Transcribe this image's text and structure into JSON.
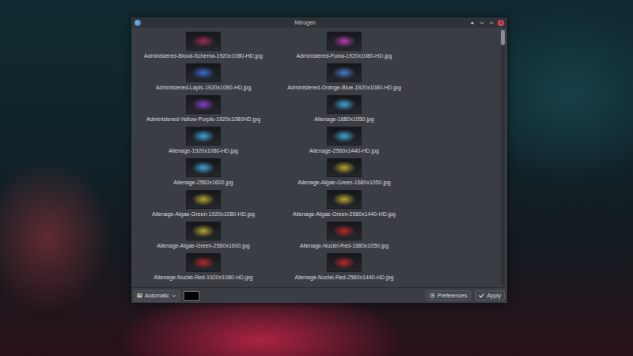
{
  "window": {
    "title": "Nitrogen"
  },
  "wallpapers": [
    {
      "name": "Administered-Blood-Schema-1920x1080-HD.jpg",
      "color": "#9a2c5a"
    },
    {
      "name": "Administered-Fuxia-1920x1080-HD.jpg",
      "color": "#b03aa8"
    },
    {
      "name": "Administered-Lapis-1920x1080-HD.jpg",
      "color": "#3a6ad0"
    },
    {
      "name": "Administered-Orange-Blue-1920x1080-HD.jpg",
      "color": "#4a78c8"
    },
    {
      "name": "Administered-Yellow-Purple-1920x1080HD.jpg",
      "color": "#8a3cc8"
    },
    {
      "name": "Alienage-1680x1050.jpg",
      "color": "#3fa6d6"
    },
    {
      "name": "Alienage-1920x1080-HD.jpg",
      "color": "#3fa6d6"
    },
    {
      "name": "Alienage-2560x1440-HD.jpg",
      "color": "#3fa6d6"
    },
    {
      "name": "Alienage-2560x1600.jpg",
      "color": "#3fa6d6"
    },
    {
      "name": "Alienage-Algae-Green-1680x1050.jpg",
      "color": "#b8a428"
    },
    {
      "name": "Alienage-Algae-Green-1920x1080-HD.jpg",
      "color": "#b8a428"
    },
    {
      "name": "Alienage-Algae-Green-2560x1440-HD.jpg",
      "color": "#b8a428"
    },
    {
      "name": "Alienage-Algae-Green-2560x1600.jpg",
      "color": "#b8a428"
    },
    {
      "name": "Alienage-Nuclei-Red-1680x1050.jpg",
      "color": "#b8282a"
    },
    {
      "name": "Alienage-Nuclei-Red-1920x1080-HD.jpg",
      "color": "#b8282a"
    },
    {
      "name": "Alienage-Nuclei-Red-2560x1440-HD.jpg",
      "color": "#b8282a"
    }
  ],
  "scrollbar": {
    "level": 0.06
  },
  "toolbar": {
    "mode": "Automatic",
    "background_color": "#000000",
    "buttons": [
      {
        "label": "Preferences",
        "kind": "preferences"
      },
      {
        "label": "Apply",
        "kind": "apply"
      }
    ]
  }
}
